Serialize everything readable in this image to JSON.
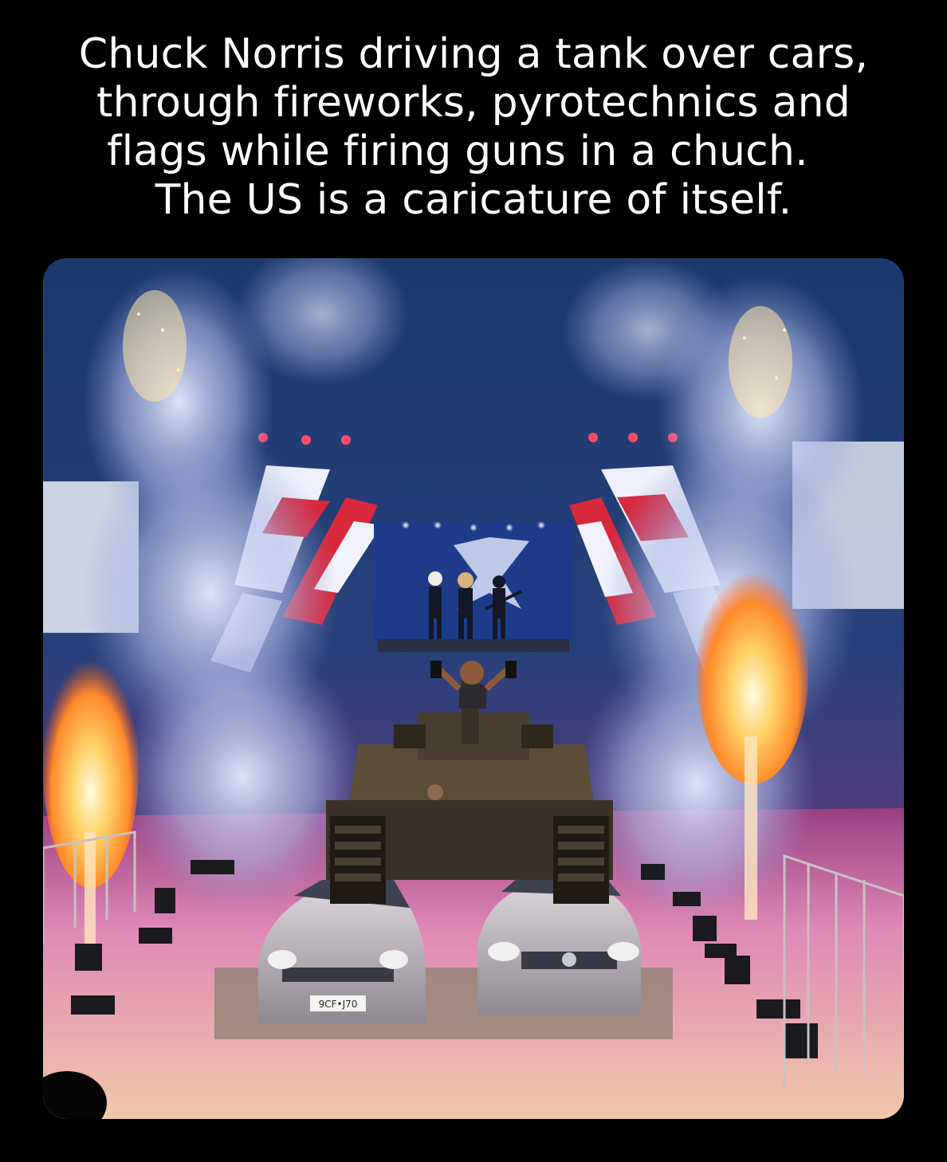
{
  "caption": {
    "lines": [
      "Chuck Norris driving a tank over cars,",
      "through fireworks, pyrotechnics and",
      "flags while firing guns in a chuch.",
      "The US is a caricature of itself."
    ]
  },
  "photo": {
    "license_plate": "9CF•J70",
    "colors": {
      "background": "#000000",
      "caption_text": "#ffffff",
      "smoke": "#cfd6ee",
      "flame": "#ffb347",
      "flag_red": "#d8283c",
      "floor": "#e8a0c0"
    }
  }
}
